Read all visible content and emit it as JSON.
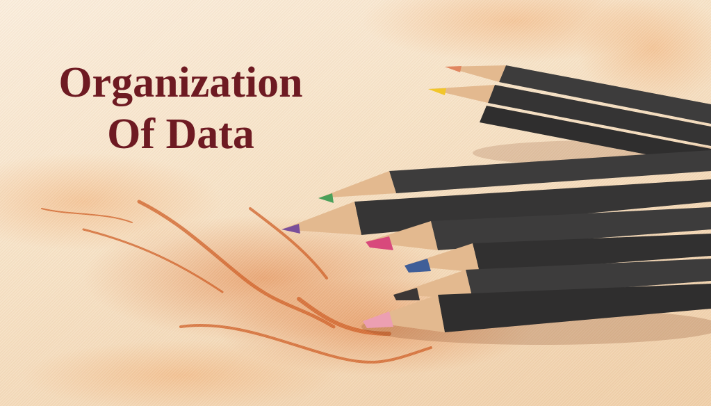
{
  "slide": {
    "title_line1": "Organization",
    "title_line2": "Of Data"
  },
  "colors": {
    "title": "#6e1a22",
    "background": "#f6e2c8",
    "stain": "#d9692b",
    "pencil_body": "#3d3c3c",
    "pencil_wood": "#e3b98f"
  },
  "image": {
    "subject": "colored-pencils-on-stained-paper",
    "pencil_tip_colors": [
      "#e08660",
      "#f2c62a",
      "#4aa05a",
      "#7a4e9a",
      "#d8497c",
      "#3f5e98",
      "#3b3636",
      "#ec9fb2"
    ]
  }
}
